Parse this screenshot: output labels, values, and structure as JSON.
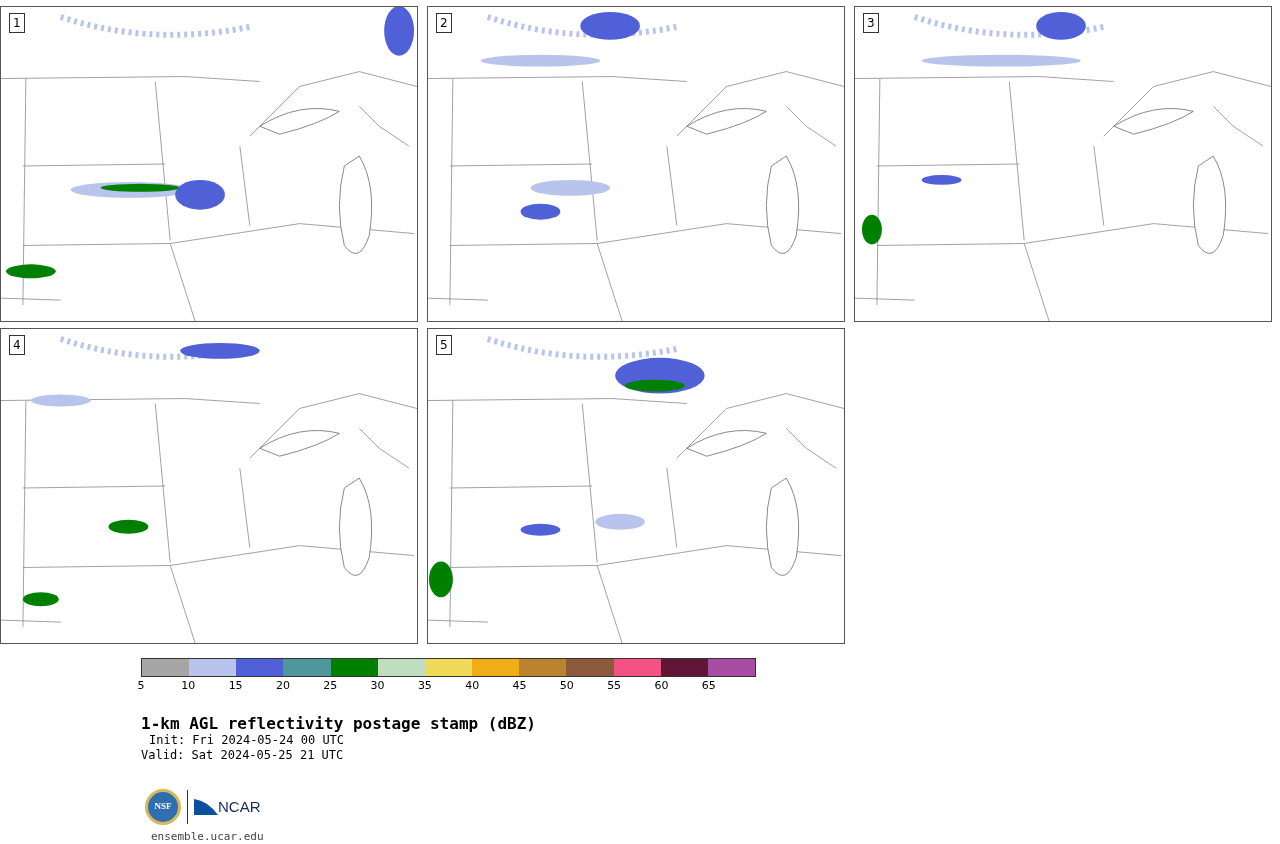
{
  "panels": [
    {
      "label": "1"
    },
    {
      "label": "2"
    },
    {
      "label": "3"
    },
    {
      "label": "4"
    },
    {
      "label": "5"
    }
  ],
  "colorbar": {
    "bins": [
      {
        "color": "#a6a6a6"
      },
      {
        "color": "#b8c4ec"
      },
      {
        "color": "#5060d6"
      },
      {
        "color": "#4f979c"
      },
      {
        "color": "#008000"
      },
      {
        "color": "#c0ddc0"
      },
      {
        "color": "#f0da5a"
      },
      {
        "color": "#efad18"
      },
      {
        "color": "#bb8330"
      },
      {
        "color": "#8c5a3c"
      },
      {
        "color": "#f45282"
      },
      {
        "color": "#5f1637"
      },
      {
        "color": "#a84ca4"
      }
    ],
    "ticks": [
      "5",
      "10",
      "15",
      "20",
      "25",
      "30",
      "35",
      "40",
      "45",
      "50",
      "55",
      "60",
      "65"
    ]
  },
  "title": "1-km AGL reflectivity postage stamp (dBZ)",
  "init": "Init: Fri 2024-05-24 00 UTC",
  "valid": "Valid: Sat 2024-05-25 21 UTC",
  "logos": {
    "nsf": "NSF",
    "ncar": "NCAR"
  },
  "site": "ensemble.ucar.edu"
}
